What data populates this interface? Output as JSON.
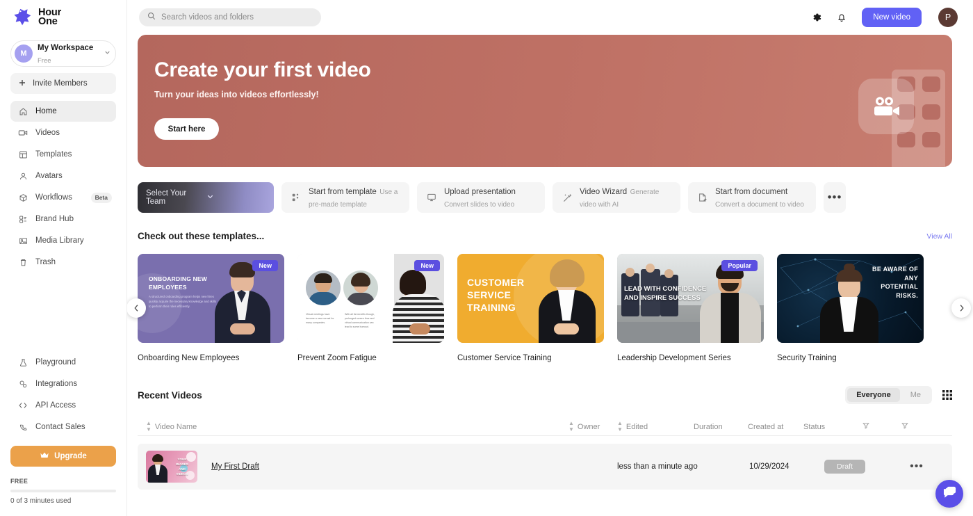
{
  "brand": {
    "name_line1": "Hour",
    "name_line2": "One",
    "logo_icon": "hourone-star-logo"
  },
  "workspace": {
    "avatar_initial": "M",
    "name": "My Workspace",
    "plan": "Free",
    "chevron_icon": "chevron-down-icon"
  },
  "invite": {
    "label": "Invite Members",
    "icon": "plus-icon"
  },
  "sidebar": {
    "items": [
      {
        "label": "Home",
        "icon": "home-icon",
        "active": true
      },
      {
        "label": "Videos",
        "icon": "video-camera-icon",
        "active": false
      },
      {
        "label": "Templates",
        "icon": "layout-template-icon",
        "active": false
      },
      {
        "label": "Avatars",
        "icon": "user-icon",
        "active": false
      },
      {
        "label": "Workflows",
        "icon": "cube-icon",
        "active": false,
        "badge": "Beta"
      },
      {
        "label": "Brand Hub",
        "icon": "brand-hub-icon",
        "active": false
      },
      {
        "label": "Media Library",
        "icon": "image-icon",
        "active": false
      },
      {
        "label": "Trash",
        "icon": "trash-icon",
        "active": false
      }
    ],
    "bottom_items": [
      {
        "label": "Playground",
        "icon": "flask-icon"
      },
      {
        "label": "Integrations",
        "icon": "integrations-icon"
      },
      {
        "label": "API Access",
        "icon": "code-brackets-icon"
      },
      {
        "label": "Contact Sales",
        "icon": "phone-icon"
      }
    ],
    "upgrade": {
      "label": "Upgrade",
      "icon": "crown-icon",
      "color": "#eba14a"
    },
    "usage": {
      "plan_label": "FREE",
      "used_text": "0 of 3 minutes used",
      "progress_percent": 0
    }
  },
  "topbar": {
    "search": {
      "placeholder": "Search videos and folders",
      "value": "",
      "icon": "search-icon"
    },
    "settings_icon": "gear-icon",
    "notifications_icon": "bell-icon",
    "new_video_label": "New video",
    "new_video_color": "#6161f5",
    "profile_initial": "P"
  },
  "hero": {
    "title": "Create your first video",
    "subtitle": "Turn your ideas into videos effortlessly!",
    "cta_label": "Start here",
    "background_color": "#bf7165",
    "art_icon": "video-camera-icon"
  },
  "actions": {
    "team_selector": {
      "label": "Select Your Team",
      "chevron_icon": "chevron-down-icon"
    },
    "cards": [
      {
        "title": "Start from template",
        "subtitle": "Use a pre-made template",
        "icon": "grid-blocks-icon"
      },
      {
        "title": "Upload presentation",
        "subtitle": "Convert slides to video",
        "icon": "presentation-icon"
      },
      {
        "title": "Video Wizard",
        "subtitle": "Generate video with AI",
        "icon": "magic-wand-icon"
      },
      {
        "title": "Start from document",
        "subtitle": "Convert a document to video",
        "icon": "document-edit-icon"
      }
    ],
    "more_label": "•••"
  },
  "templates_section": {
    "title": "Check out these templates...",
    "view_all_label": "View All",
    "prev_icon": "chevron-left-icon",
    "next_icon": "chevron-right-icon",
    "items": [
      {
        "name": "Onboarding New Employees",
        "badge": "New",
        "thumb_headline": "ONBOARDING NEW EMPLOYEES",
        "thumb_body": "A structured onboarding program helps new hires quickly acquire the necessary knowledge and skills to perform their roles efficiently."
      },
      {
        "name": "Prevent Zoom Fatigue",
        "badge": "New",
        "thumb_body_left": "Virtual meetings have become a new normal for many companies.",
        "thumb_body_right": "With all its benefits though, prolonged screen time and virtual communication can lead to some burnout."
      },
      {
        "name": "Customer Service Training",
        "badge": "",
        "thumb_headline": "CUSTOMER SERVICE TRAINING"
      },
      {
        "name": "Leadership Development Series",
        "badge": "Popular",
        "thumb_headline": "LEAD WITH CONFIDENCE AND INSPIRE SUCCESS"
      },
      {
        "name": "Security Training",
        "badge": "",
        "thumb_headline": "BE AWARE OF ANY POTENTIAL RISKS."
      }
    ]
  },
  "recent_videos": {
    "title": "Recent Videos",
    "filter_everyone": "Everyone",
    "filter_me": "Me",
    "grid_view_icon": "grid-view-icon",
    "columns": {
      "name": "Video Name",
      "owner": "Owner",
      "edited": "Edited",
      "duration": "Duration",
      "created_at": "Created at",
      "status": "Status",
      "filter_icon": "filter-icon"
    },
    "rows": [
      {
        "name": "My First Draft",
        "thumb_text": "YOUR IMAGES AND VIDEOS",
        "owner": "",
        "edited": "less than a minute ago",
        "duration": "",
        "created_at": "10/29/2024",
        "status": "Draft",
        "more_label": "•••"
      }
    ]
  },
  "chat_widget": {
    "icon": "chat-bubbles-icon",
    "color": "#5b4fe8"
  }
}
